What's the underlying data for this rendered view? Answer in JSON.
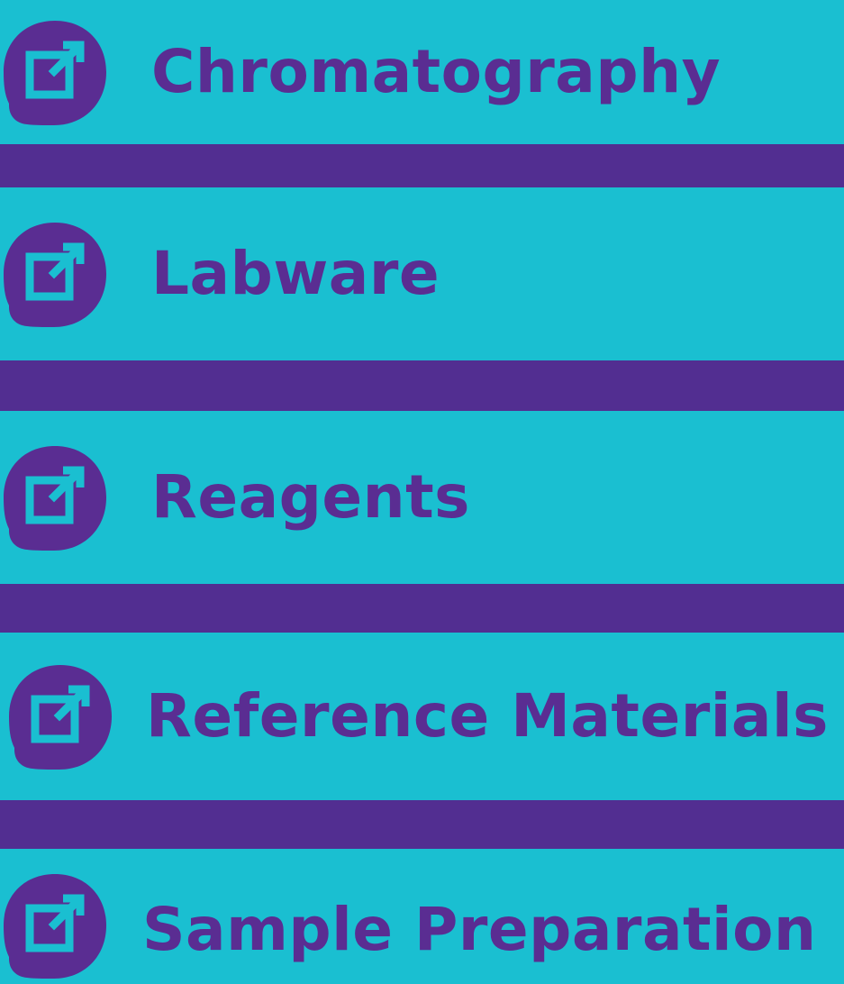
{
  "colors": {
    "background": "#522e91",
    "row_background": "#1abfd1",
    "text": "#5a2d92",
    "icon_fill": "#5a2d92",
    "icon_stroke": "#1abfd1"
  },
  "links": [
    {
      "label": "Chromatography",
      "icon": "external-link-icon"
    },
    {
      "label": "Labware",
      "icon": "external-link-icon"
    },
    {
      "label": "Reagents",
      "icon": "external-link-icon"
    },
    {
      "label": "Reference Materials",
      "icon": "external-link-icon"
    },
    {
      "label": "Sample Preparation",
      "icon": "external-link-icon"
    }
  ]
}
